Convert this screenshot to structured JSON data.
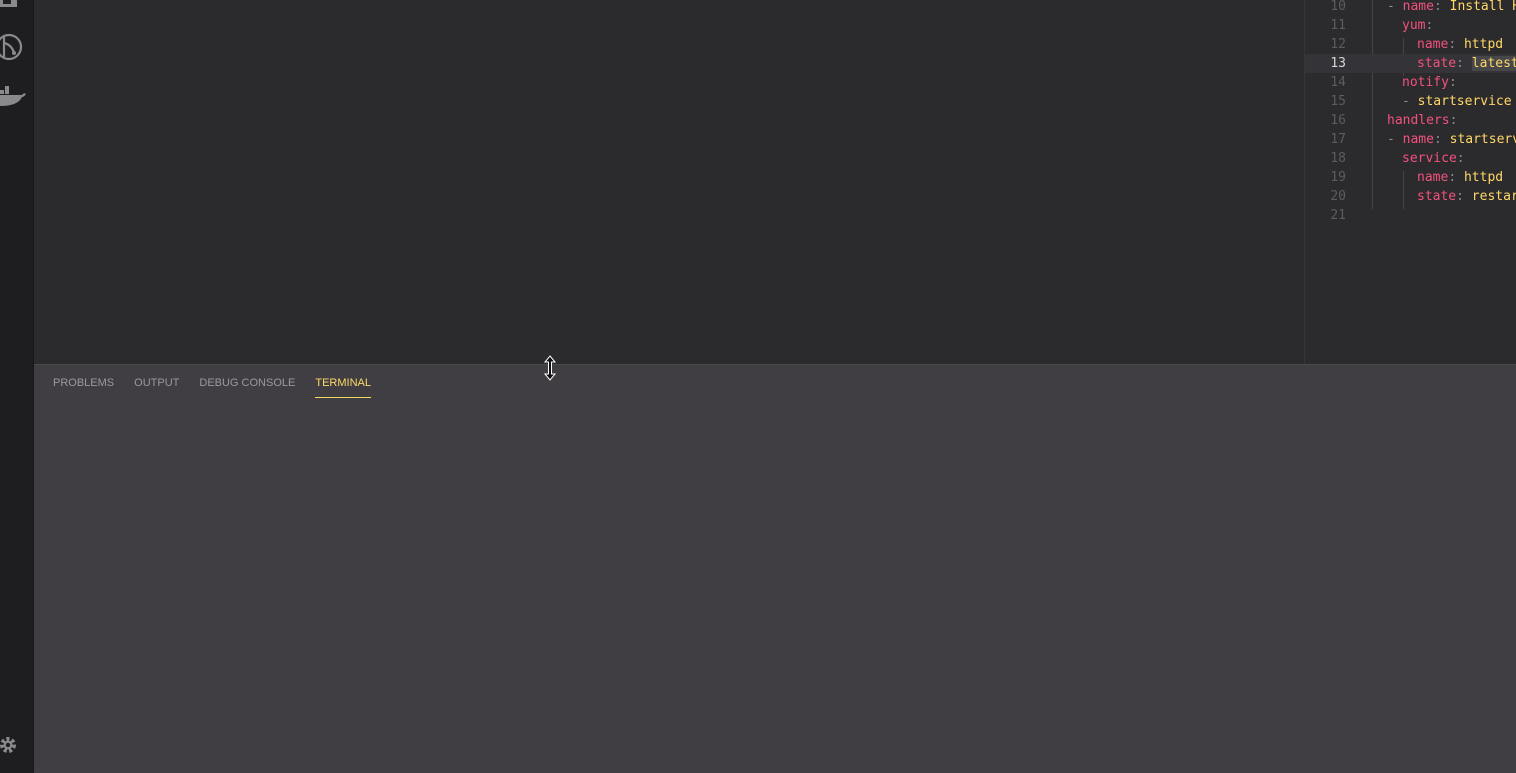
{
  "editor": {
    "lines": [
      {
        "num": "10",
        "indent": 0,
        "tokens": [
          {
            "t": "- ",
            "c": "dash"
          },
          {
            "t": "name",
            "c": "key"
          },
          {
            "t": ": ",
            "c": "dash"
          },
          {
            "t": "Install H",
            "c": "val"
          }
        ]
      },
      {
        "num": "11",
        "indent": 1,
        "tokens": [
          {
            "t": "yum",
            "c": "key"
          },
          {
            "t": ":",
            "c": "dash"
          }
        ]
      },
      {
        "num": "12",
        "indent": 2,
        "tokens": [
          {
            "t": "name",
            "c": "key"
          },
          {
            "t": ": ",
            "c": "dash"
          },
          {
            "t": "httpd",
            "c": "val"
          }
        ]
      },
      {
        "num": "13",
        "indent": 2,
        "current": true,
        "tokens": [
          {
            "t": "state",
            "c": "key"
          },
          {
            "t": ": ",
            "c": "dash"
          },
          {
            "t": "latest",
            "c": "val hl"
          }
        ]
      },
      {
        "num": "14",
        "indent": 1,
        "tokens": [
          {
            "t": "notify",
            "c": "key"
          },
          {
            "t": ":",
            "c": "dash"
          }
        ]
      },
      {
        "num": "15",
        "indent": 1,
        "tokens": [
          {
            "t": "- ",
            "c": "dash"
          },
          {
            "t": "startservice",
            "c": "val"
          }
        ]
      },
      {
        "num": "16",
        "indent": 0,
        "tokens": [
          {
            "t": "handlers",
            "c": "key"
          },
          {
            "t": ":",
            "c": "dash"
          }
        ]
      },
      {
        "num": "17",
        "indent": 0,
        "tokens": [
          {
            "t": "- ",
            "c": "dash"
          },
          {
            "t": "name",
            "c": "key"
          },
          {
            "t": ": ",
            "c": "dash"
          },
          {
            "t": "startserv",
            "c": "val"
          }
        ]
      },
      {
        "num": "18",
        "indent": 1,
        "tokens": [
          {
            "t": "service",
            "c": "key"
          },
          {
            "t": ":",
            "c": "dash"
          }
        ]
      },
      {
        "num": "19",
        "indent": 2,
        "tokens": [
          {
            "t": "name",
            "c": "key"
          },
          {
            "t": ": ",
            "c": "dash"
          },
          {
            "t": "httpd",
            "c": "val"
          }
        ]
      },
      {
        "num": "20",
        "indent": 2,
        "tokens": [
          {
            "t": "state",
            "c": "key"
          },
          {
            "t": ": ",
            "c": "dash"
          },
          {
            "t": "restar",
            "c": "val"
          }
        ]
      },
      {
        "num": "21",
        "indent": 0,
        "tokens": []
      }
    ]
  },
  "panel": {
    "tabs": [
      {
        "label": "PROBLEMS",
        "active": false
      },
      {
        "label": "OUTPUT",
        "active": false
      },
      {
        "label": "DEBUG CONSOLE",
        "active": false
      },
      {
        "label": "TERMINAL",
        "active": true
      }
    ]
  },
  "activity_bar": {
    "icons": [
      "explorer-icon",
      "git-icon",
      "docker-icon",
      "gear-icon"
    ]
  },
  "colors": {
    "accent": "#ffd866",
    "key": "#f2527e",
    "panel_bg": "#403e42",
    "editor_bg": "#2b2a2d"
  }
}
